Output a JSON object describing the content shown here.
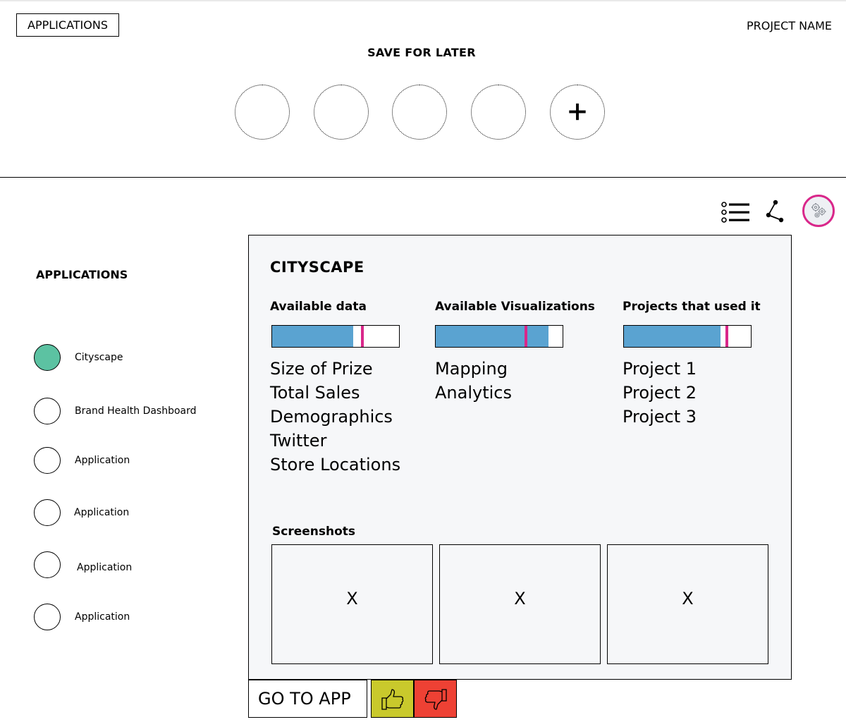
{
  "header": {
    "applications_button": "APPLICATIONS",
    "project_name": "PROJECT NAME",
    "save_for_later_title": "SAVE FOR LATER",
    "slots": [
      {
        "state": "empty"
      },
      {
        "state": "empty"
      },
      {
        "state": "empty"
      },
      {
        "state": "empty"
      },
      {
        "state": "add",
        "icon": "plus-icon"
      }
    ]
  },
  "toolbar": {
    "icons": [
      "list-view-icon",
      "graph-view-icon",
      "settings-gears-icon"
    ],
    "accent_color": "#d9278a"
  },
  "sidebar": {
    "title": "APPLICATIONS",
    "items": [
      {
        "label": "Cityscape",
        "active": true
      },
      {
        "label": "Brand Health Dashboard",
        "active": false
      },
      {
        "label": "Application",
        "active": false
      },
      {
        "label": "Application",
        "active": false
      },
      {
        "label": "Application",
        "active": false
      },
      {
        "label": "Application",
        "active": false
      }
    ],
    "active_color": "#5cc2a2"
  },
  "detail": {
    "title": "CITYSCAPE",
    "columns": [
      {
        "title": "Available data",
        "bar": {
          "fill_pct": 64,
          "marker_pct": 71
        },
        "items": [
          "Size of Prize",
          "Total Sales",
          "Demographics",
          "Twitter",
          "Store Locations"
        ]
      },
      {
        "title": "Available Visualizations",
        "bar": {
          "fill_pct": 89,
          "marker_pct": 71
        },
        "items": [
          "Mapping",
          "Analytics"
        ]
      },
      {
        "title": "Projects that used it",
        "bar": {
          "fill_pct": 76,
          "marker_pct": 81
        },
        "items": [
          "Project 1",
          "Project 2",
          "Project 3"
        ]
      }
    ],
    "bar_fill_color": "#5aa3d1",
    "bar_marker_color": "#d9278a",
    "screenshots_title": "Screenshots",
    "screenshots": [
      "X",
      "X",
      "X"
    ]
  },
  "actions": {
    "go_to_app": "GO TO APP",
    "thumbs_up_color": "#c9c92c",
    "thumbs_down_color": "#ee4134"
  }
}
